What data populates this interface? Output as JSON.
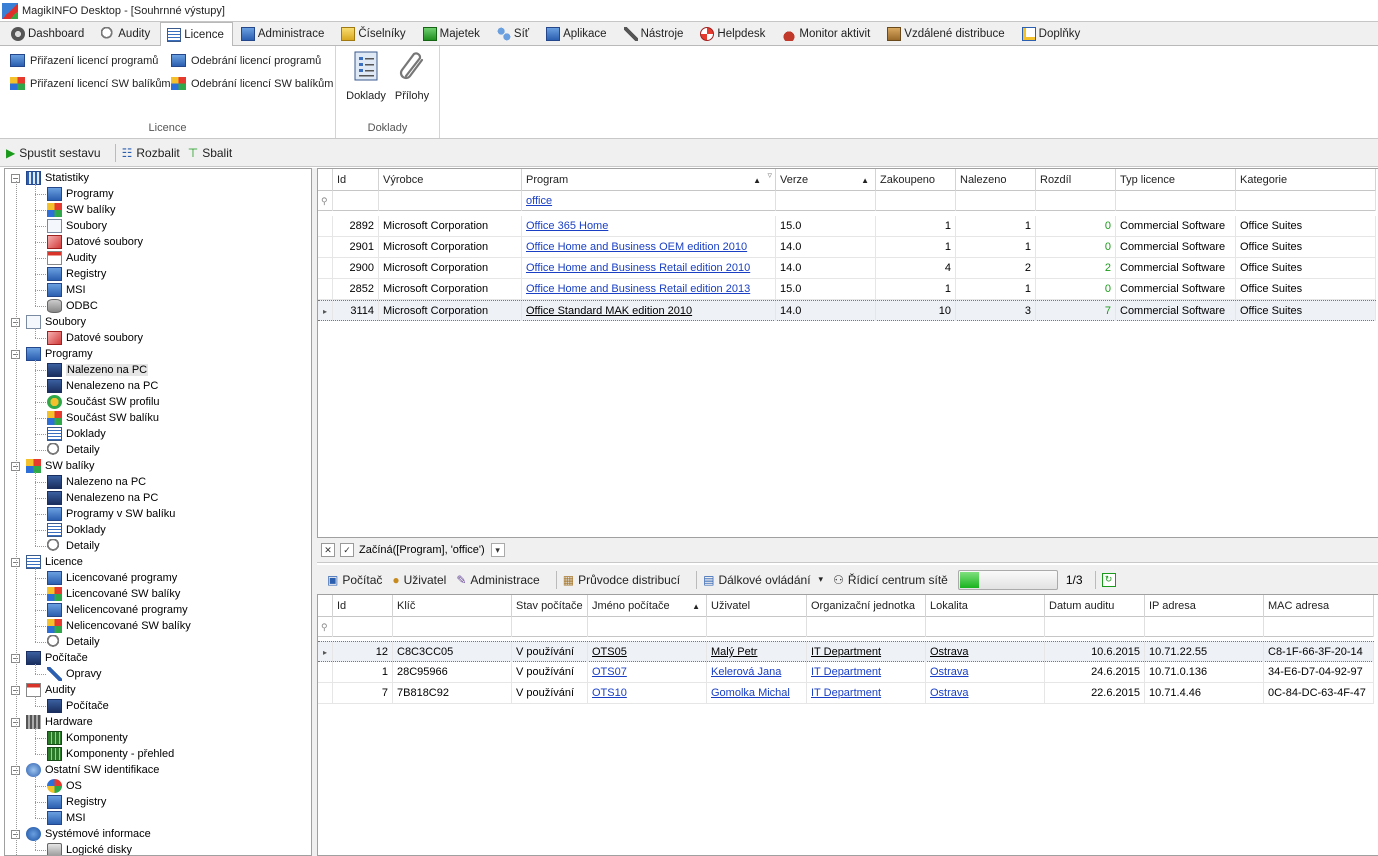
{
  "window": {
    "title": "MagikINFO Desktop - [Souhrnné výstupy]"
  },
  "tabs": [
    {
      "label": "Dashboard",
      "icon": "dashboard-icon"
    },
    {
      "label": "Audity",
      "icon": "magnifier-icon"
    },
    {
      "label": "Licence",
      "icon": "licence-icon",
      "active": true
    },
    {
      "label": "Administrace",
      "icon": "window-icon"
    },
    {
      "label": "Číselníky",
      "icon": "folder-icon"
    },
    {
      "label": "Majetek",
      "icon": "money-icon"
    },
    {
      "label": "Síť",
      "icon": "network-icon"
    },
    {
      "label": "Aplikace",
      "icon": "window-icon"
    },
    {
      "label": "Nástroje",
      "icon": "tools-icon"
    },
    {
      "label": "Helpdesk",
      "icon": "lifebuoy-icon"
    },
    {
      "label": "Monitor aktivit",
      "icon": "spy-icon"
    },
    {
      "label": "Vzdálené distribuce",
      "icon": "box-icon"
    },
    {
      "label": "Doplňky",
      "icon": "addon-icon"
    }
  ],
  "ribbon": {
    "licence_group": {
      "label": "Licence",
      "assign_programs": "Přiřazení licencí programů",
      "assign_packages": "Přiřazení licencí SW balíkům",
      "remove_programs": "Odebrání licencí programů",
      "remove_packages": "Odebrání licencí SW balíkům"
    },
    "doklady_group": {
      "label": "Doklady",
      "doklady": "Doklady",
      "prilohy": "Přílohy"
    }
  },
  "toolbar": {
    "run": "Spustit sestavu",
    "expand": "Rozbalit",
    "collapse": "Sbalit"
  },
  "tree": [
    {
      "label": "Statistiky",
      "level": 0,
      "icon": "stats-icon",
      "expanded": true
    },
    {
      "label": "Programy",
      "level": 1,
      "icon": "window-icon"
    },
    {
      "label": "SW balíky",
      "level": 1,
      "icon": "package-icon"
    },
    {
      "label": "Soubory",
      "level": 1,
      "icon": "file-icon"
    },
    {
      "label": "Datové soubory",
      "level": 1,
      "icon": "datafile-icon"
    },
    {
      "label": "Audity",
      "level": 1,
      "icon": "calendar-icon"
    },
    {
      "label": "Registry",
      "level": 1,
      "icon": "window-icon"
    },
    {
      "label": "MSI",
      "level": 1,
      "icon": "window-icon"
    },
    {
      "label": "ODBC",
      "level": 1,
      "icon": "database-icon"
    },
    {
      "label": "Soubory",
      "level": 0,
      "icon": "file-icon",
      "expanded": true
    },
    {
      "label": "Datové soubory",
      "level": 1,
      "icon": "datafile-icon"
    },
    {
      "label": "Programy",
      "level": 0,
      "icon": "window-icon",
      "expanded": true
    },
    {
      "label": "Nalezeno na PC",
      "level": 1,
      "icon": "pc-icon",
      "selected": true
    },
    {
      "label": "Nenalezeno na PC",
      "level": 1,
      "icon": "pc-icon"
    },
    {
      "label": "Součást SW profilu",
      "level": 1,
      "icon": "profile-icon"
    },
    {
      "label": "Součást SW balíku",
      "level": 1,
      "icon": "package-icon"
    },
    {
      "label": "Doklady",
      "level": 1,
      "icon": "document-icon"
    },
    {
      "label": "Detaily",
      "level": 1,
      "icon": "magnifier-icon"
    },
    {
      "label": "SW balíky",
      "level": 0,
      "icon": "package-icon",
      "expanded": true
    },
    {
      "label": "Nalezeno na PC",
      "level": 1,
      "icon": "pc-icon"
    },
    {
      "label": "Nenalezeno na PC",
      "level": 1,
      "icon": "pc-icon"
    },
    {
      "label": "Programy v SW balíku",
      "level": 1,
      "icon": "window-icon"
    },
    {
      "label": "Doklady",
      "level": 1,
      "icon": "document-icon"
    },
    {
      "label": "Detaily",
      "level": 1,
      "icon": "magnifier-icon"
    },
    {
      "label": "Licence",
      "level": 0,
      "icon": "document-icon",
      "expanded": true
    },
    {
      "label": "Licencované programy",
      "level": 1,
      "icon": "window-icon"
    },
    {
      "label": "Licencované SW balíky",
      "level": 1,
      "icon": "package-icon"
    },
    {
      "label": "Nelicencované programy",
      "level": 1,
      "icon": "window-icon"
    },
    {
      "label": "Nelicencované SW balíky",
      "level": 1,
      "icon": "package-icon"
    },
    {
      "label": "Detaily",
      "level": 1,
      "icon": "magnifier-icon"
    },
    {
      "label": "Počítače",
      "level": 0,
      "icon": "pc-icon",
      "expanded": true
    },
    {
      "label": "Opravy",
      "level": 1,
      "icon": "wrench-icon"
    },
    {
      "label": "Audity",
      "level": 0,
      "icon": "calendar-icon",
      "expanded": true
    },
    {
      "label": "Počítače",
      "level": 1,
      "icon": "pc-icon"
    },
    {
      "label": "Hardware",
      "level": 0,
      "icon": "chip-icon",
      "expanded": true
    },
    {
      "label": "Komponenty",
      "level": 1,
      "icon": "board-icon"
    },
    {
      "label": "Komponenty - přehled",
      "level": 1,
      "icon": "board-icon"
    },
    {
      "label": "Ostatní SW identifikace",
      "level": 0,
      "icon": "sw-id-icon",
      "expanded": true
    },
    {
      "label": "OS",
      "level": 1,
      "icon": "windows-logo-icon"
    },
    {
      "label": "Registry",
      "level": 1,
      "icon": "window-icon"
    },
    {
      "label": "MSI",
      "level": 1,
      "icon": "window-icon"
    },
    {
      "label": "Systémové informace",
      "level": 0,
      "icon": "info-icon",
      "expanded": true
    },
    {
      "label": "Logické disky",
      "level": 1,
      "icon": "disk-icon"
    }
  ],
  "grid1": {
    "columns": [
      "Id",
      "Výrobce",
      "Program",
      "Verze",
      "Zakoupeno",
      "Nalezeno",
      "Rozdíl",
      "Typ licence",
      "Kategorie"
    ],
    "filter_value": "office",
    "rows": [
      {
        "id": "2892",
        "vendor": "Microsoft Corporation",
        "program": "Office 365 Home",
        "version": "15.0",
        "bought": "1",
        "found": "1",
        "diff": "0",
        "type": "Commercial Software",
        "category": "Office Suites"
      },
      {
        "id": "2901",
        "vendor": "Microsoft Corporation",
        "program": "Office Home and Business OEM edition 2010",
        "version": "14.0",
        "bought": "1",
        "found": "1",
        "diff": "0",
        "type": "Commercial Software",
        "category": "Office Suites"
      },
      {
        "id": "2900",
        "vendor": "Microsoft Corporation",
        "program": "Office Home and Business Retail edition 2010",
        "version": "14.0",
        "bought": "4",
        "found": "2",
        "diff": "2",
        "type": "Commercial Software",
        "category": "Office Suites"
      },
      {
        "id": "2852",
        "vendor": "Microsoft Corporation",
        "program": "Office Home and Business Retail edition 2013",
        "version": "15.0",
        "bought": "1",
        "found": "1",
        "diff": "0",
        "type": "Commercial Software",
        "category": "Office Suites"
      },
      {
        "id": "3114",
        "vendor": "Microsoft Corporation",
        "program": "Office Standard MAK edition 2010",
        "version": "14.0",
        "bought": "10",
        "found": "3",
        "diff": "7",
        "type": "Commercial Software",
        "category": "Office Suites",
        "current": true
      }
    ]
  },
  "filterbar": {
    "expression": "Začíná([Program], 'office')"
  },
  "toolbar3": {
    "computer": "Počítač",
    "user": "Uživatel",
    "admin": "Administrace",
    "distribution": "Průvodce distribucí",
    "remote": "Dálkové ovládání",
    "control": "Řídicí centrum sítě",
    "progress_percent": 20,
    "pager": "1/3"
  },
  "grid2": {
    "columns": [
      "Id",
      "Klíč",
      "Stav počítače",
      "Jméno počítače",
      "Uživatel",
      "Organizační jednotka",
      "Lokalita",
      "Datum auditu",
      "IP adresa",
      "MAC adresa"
    ],
    "rows": [
      {
        "id": "12",
        "key": "C8C3CC05",
        "state": "V používání",
        "name": "OTS05",
        "user": "Malý Petr",
        "unit": "IT Department",
        "location": "Ostrava",
        "date": "10.6.2015",
        "ip": "10.71.22.55",
        "mac": "C8-1F-66-3F-20-14",
        "current": true
      },
      {
        "id": "1",
        "key": "28C95966",
        "state": "V používání",
        "name": "OTS07",
        "user": "Kelerová Jana",
        "unit": "IT Department",
        "location": "Ostrava",
        "date": "24.6.2015",
        "ip": "10.71.0.136",
        "mac": "34-E6-D7-04-92-97"
      },
      {
        "id": "7",
        "key": "7B818C92",
        "state": "V používání",
        "name": "OTS10",
        "user": "Gomolka Michal",
        "unit": "IT Department",
        "location": "Ostrava",
        "date": "22.6.2015",
        "ip": "10.71.4.46",
        "mac": "0C-84-DC-63-4F-47"
      }
    ]
  }
}
